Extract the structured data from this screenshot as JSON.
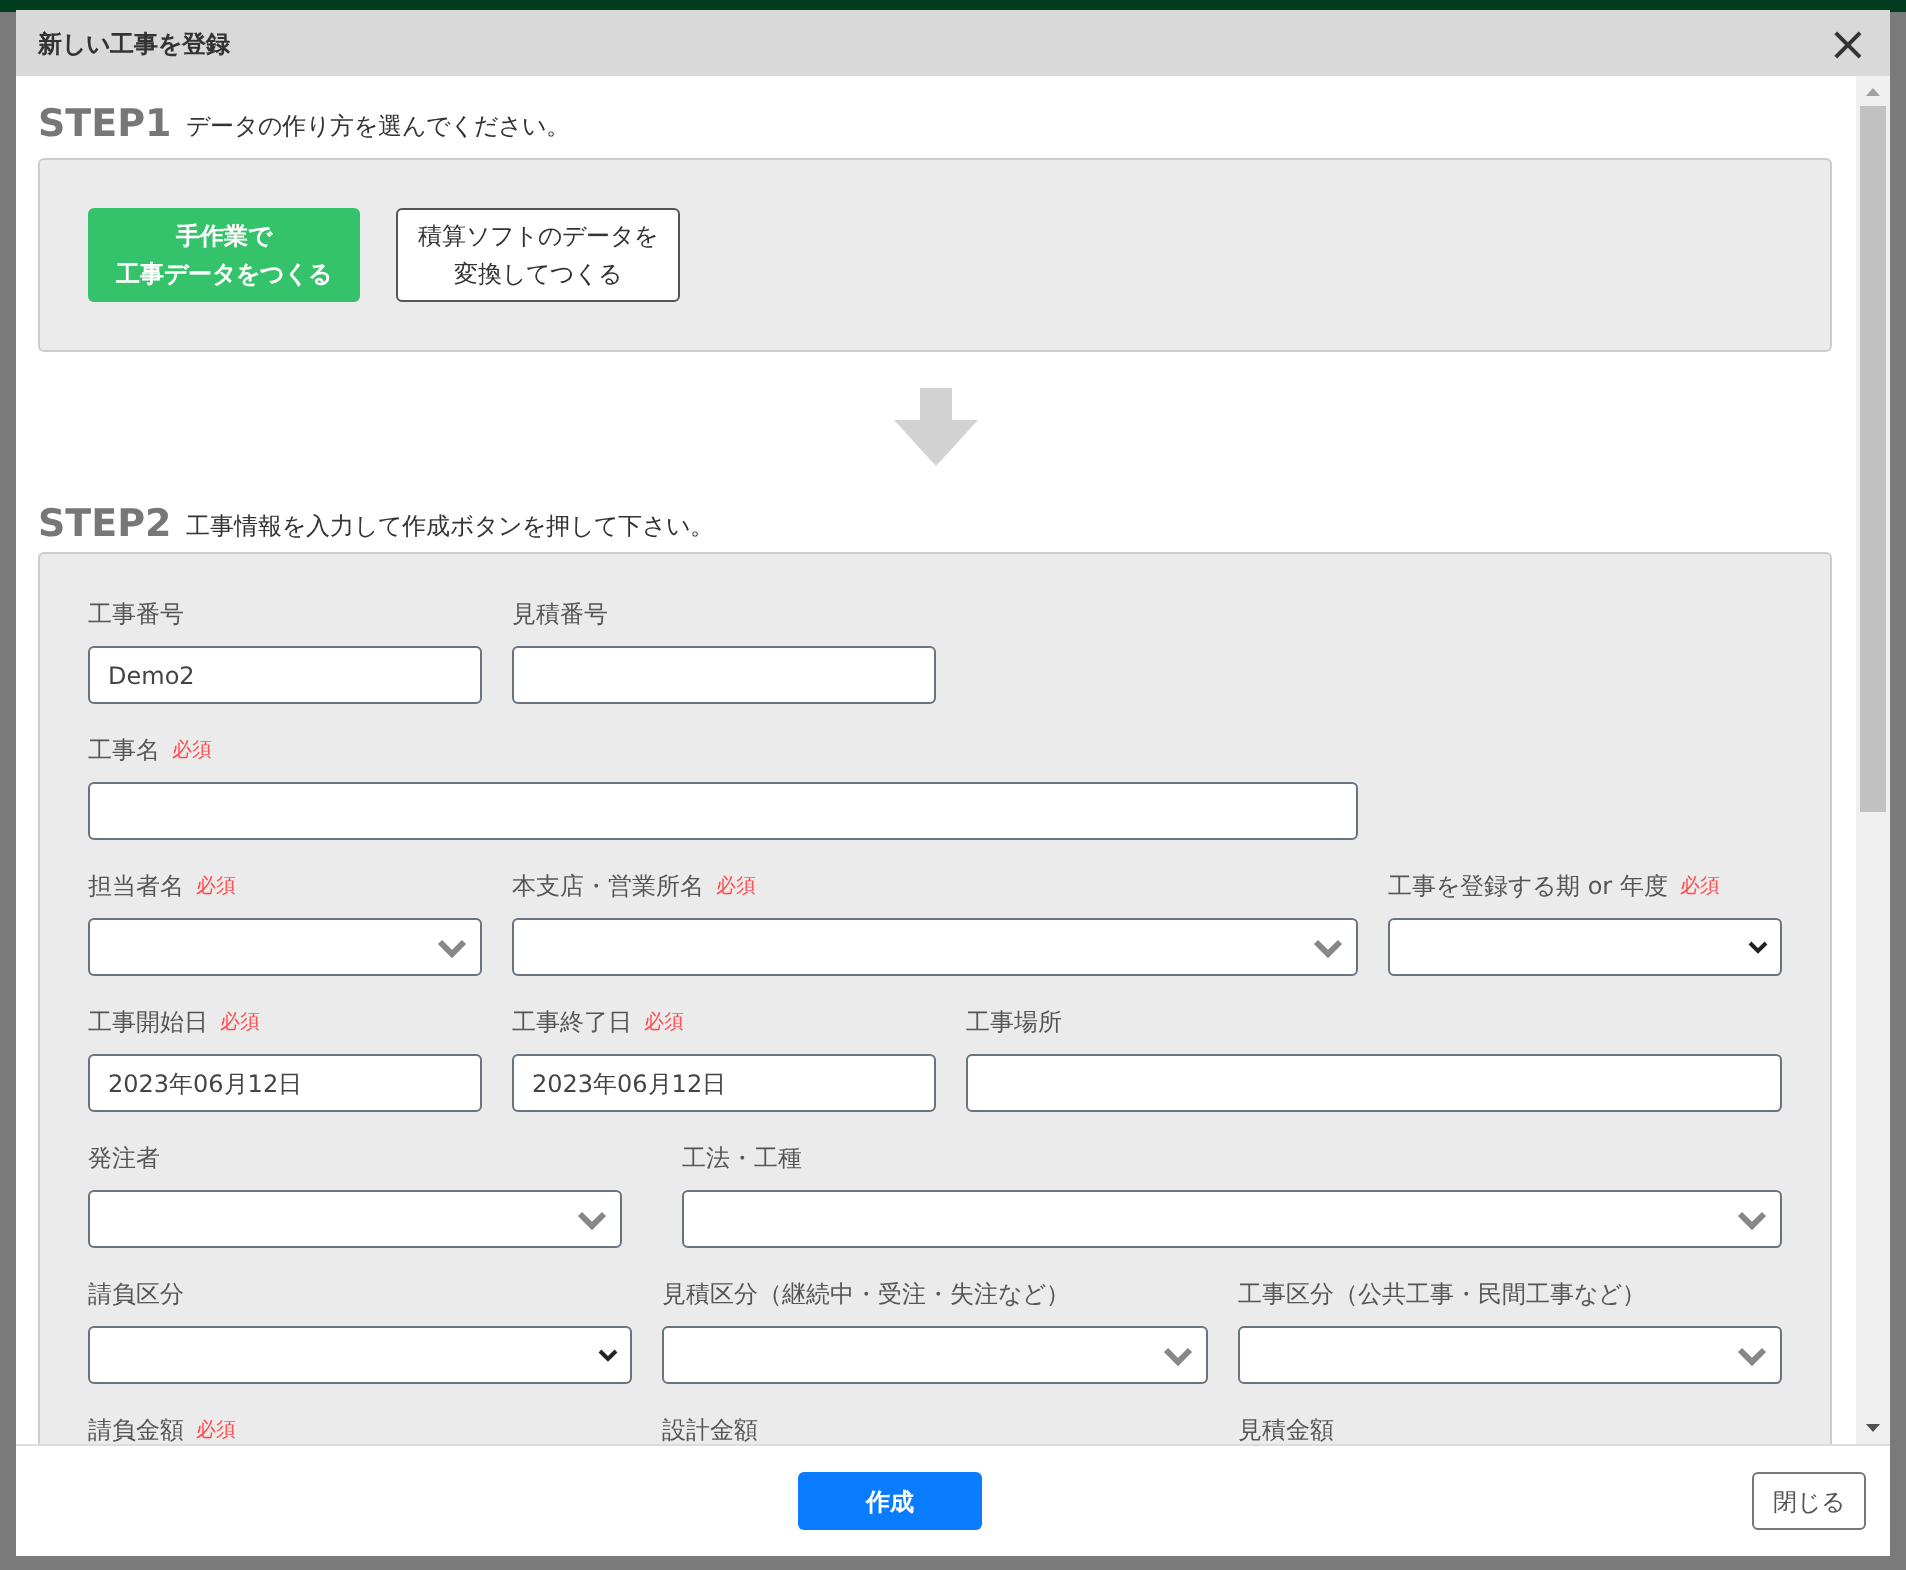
{
  "dialog": {
    "title": "新しい工事を登録",
    "close": "×"
  },
  "step1": {
    "label": "STEP1",
    "instruction": "データの作り方を選んでください。",
    "options": [
      {
        "lines": [
          "手作業で",
          "工事データをつくる"
        ],
        "selected": true
      },
      {
        "lines": [
          "積算ソフトのデータを",
          "変換してつくる"
        ],
        "selected": false
      }
    ]
  },
  "step2": {
    "label": "STEP2",
    "instruction": "工事情報を入力して作成ボタンを押して下さい。",
    "rows": [
      [
        {
          "label": "工事番号",
          "kind": "text",
          "value": "Demo2"
        },
        {
          "label": "見積番号",
          "kind": "text"
        }
      ],
      [
        {
          "label": "工事名",
          "required_mark": "必須",
          "kind": "text"
        }
      ],
      [
        {
          "label": "担当者名",
          "required_mark": "必須",
          "kind": "select"
        },
        {
          "label": "本支店・営業所名",
          "required_mark": "必須",
          "kind": "select"
        },
        {
          "label": "工事を登録する期 or 年度",
          "required_mark": "必須",
          "kind": "native-select"
        }
      ],
      [
        {
          "label": "工事開始日",
          "required_mark": "必須",
          "kind": "text",
          "value": "2023年06月12日"
        },
        {
          "label": "工事終了日",
          "required_mark": "必須",
          "kind": "text",
          "value": "2023年06月12日"
        },
        {
          "label": "工事場所",
          "kind": "text"
        }
      ],
      [
        {
          "label": "発注者",
          "kind": "select"
        },
        {
          "label": "工法・工種",
          "kind": "select"
        }
      ],
      [
        {
          "label": "請負区分",
          "kind": "native-select"
        },
        {
          "label": "見積区分（継続中・受注・失注など）",
          "kind": "select"
        },
        {
          "label": "工事区分（公共工事・民間工事など）",
          "kind": "select"
        }
      ],
      [
        {
          "label": "請負金額",
          "required_mark": "必須",
          "kind": "label-only"
        },
        {
          "label": "設計金額",
          "kind": "label-only"
        },
        {
          "label": "見積金額",
          "kind": "label-only"
        }
      ]
    ]
  },
  "footer": {
    "submit": "作成",
    "close": "閉じる"
  }
}
